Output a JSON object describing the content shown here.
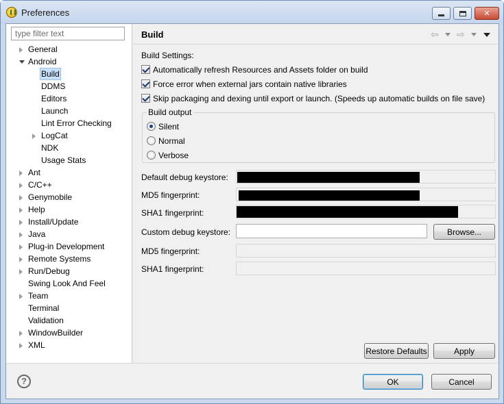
{
  "window": {
    "title": "Preferences"
  },
  "filter": {
    "placeholder": "type filter text"
  },
  "tree": {
    "items": [
      {
        "label": "General",
        "expandable": true,
        "expanded": false,
        "level": 0
      },
      {
        "label": "Android",
        "expandable": true,
        "expanded": true,
        "level": 0
      },
      {
        "label": "Build",
        "expandable": false,
        "level": 1,
        "selected": true
      },
      {
        "label": "DDMS",
        "expandable": false,
        "level": 1
      },
      {
        "label": "Editors",
        "expandable": false,
        "level": 1
      },
      {
        "label": "Launch",
        "expandable": false,
        "level": 1
      },
      {
        "label": "Lint Error Checking",
        "expandable": false,
        "level": 1
      },
      {
        "label": "LogCat",
        "expandable": true,
        "expanded": false,
        "level": 1
      },
      {
        "label": "NDK",
        "expandable": false,
        "level": 1
      },
      {
        "label": "Usage Stats",
        "expandable": false,
        "level": 1
      },
      {
        "label": "Ant",
        "expandable": true,
        "expanded": false,
        "level": 0
      },
      {
        "label": "C/C++",
        "expandable": true,
        "expanded": false,
        "level": 0
      },
      {
        "label": "Genymobile",
        "expandable": true,
        "expanded": false,
        "level": 0
      },
      {
        "label": "Help",
        "expandable": true,
        "expanded": false,
        "level": 0
      },
      {
        "label": "Install/Update",
        "expandable": true,
        "expanded": false,
        "level": 0
      },
      {
        "label": "Java",
        "expandable": true,
        "expanded": false,
        "level": 0
      },
      {
        "label": "Plug-in Development",
        "expandable": true,
        "expanded": false,
        "level": 0
      },
      {
        "label": "Remote Systems",
        "expandable": true,
        "expanded": false,
        "level": 0
      },
      {
        "label": "Run/Debug",
        "expandable": true,
        "expanded": false,
        "level": 0
      },
      {
        "label": "Swing Look And Feel",
        "expandable": false,
        "level": 0
      },
      {
        "label": "Team",
        "expandable": true,
        "expanded": false,
        "level": 0
      },
      {
        "label": "Terminal",
        "expandable": false,
        "level": 0
      },
      {
        "label": "Validation",
        "expandable": false,
        "level": 0
      },
      {
        "label": "WindowBuilder",
        "expandable": true,
        "expanded": false,
        "level": 0
      },
      {
        "label": "XML",
        "expandable": true,
        "expanded": false,
        "level": 0
      }
    ]
  },
  "page": {
    "title": "Build",
    "settings_label": "Build Settings:",
    "checkboxes": [
      {
        "label": "Automatically refresh Resources and Assets folder on build",
        "checked": true
      },
      {
        "label": "Force error when external jars contain native libraries",
        "checked": true
      },
      {
        "label": "Skip packaging and dexing until export or launch. (Speeds up automatic builds on file save)",
        "checked": true
      }
    ],
    "build_output": {
      "title": "Build output",
      "options": [
        {
          "label": "Silent",
          "selected": true
        },
        {
          "label": "Normal",
          "selected": false
        },
        {
          "label": "Verbose",
          "selected": false
        }
      ]
    },
    "fields": {
      "default_keystore_label": "Default debug keystore:",
      "md5_label": "MD5 fingerprint:",
      "sha1_label": "SHA1 fingerprint:",
      "custom_keystore_label": "Custom debug keystore:",
      "custom_keystore_value": "",
      "custom_md5_label": "MD5 fingerprint:",
      "custom_sha1_label": "SHA1 fingerprint:",
      "browse_label": "Browse..."
    },
    "restore_defaults_label": "Restore Defaults",
    "apply_label": "Apply"
  },
  "dialog": {
    "ok_label": "OK",
    "cancel_label": "Cancel"
  },
  "colors": {
    "accent": "#3c7fb1",
    "selection": "#c7e0fb",
    "frame": "#c9d9ee"
  },
  "icons": {
    "help": "question-circle-icon",
    "back": "arrow-left-icon",
    "forward": "arrow-right-icon",
    "menu": "view-menu-icon"
  }
}
